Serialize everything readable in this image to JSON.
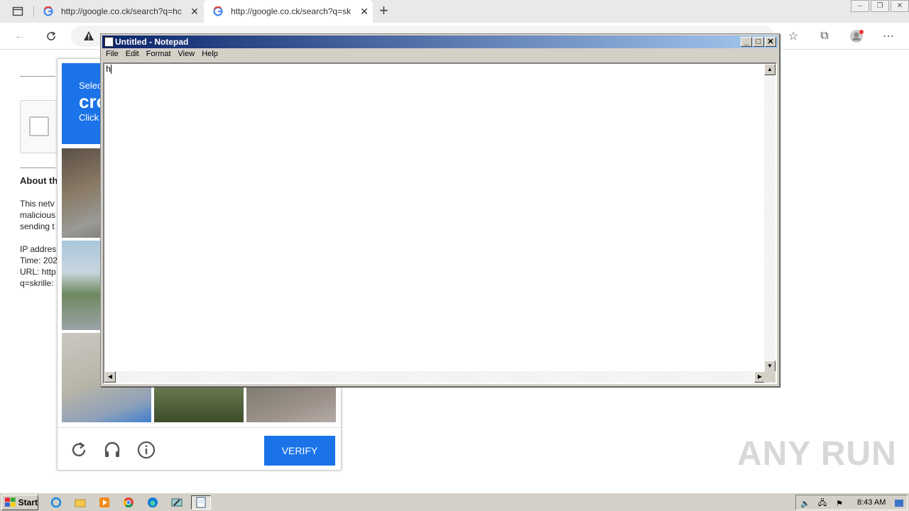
{
  "browser": {
    "tabs": [
      {
        "title": "http://google.co.ck/search?q=hc",
        "close": "✕"
      },
      {
        "title": "http://google.co.ck/search?q=sk",
        "close": "✕"
      }
    ],
    "new_tab": "+"
  },
  "page": {
    "about": "About th",
    "lines": [
      "This netv",
      "malicious",
      "sending t"
    ],
    "info": [
      "IP addres",
      "Time: 202",
      "URL: http",
      "q=skrille:"
    ]
  },
  "captcha": {
    "line1": "Selec",
    "line2": "cro",
    "line3": "Click",
    "verify": "VERIFY"
  },
  "notepad": {
    "title": "Untitled - Notepad",
    "menu": [
      "File",
      "Edit",
      "Format",
      "View",
      "Help"
    ],
    "content": "h"
  },
  "watermark": "ANY RUN",
  "taskbar": {
    "start": "Start",
    "clock": "8:43 AM"
  }
}
